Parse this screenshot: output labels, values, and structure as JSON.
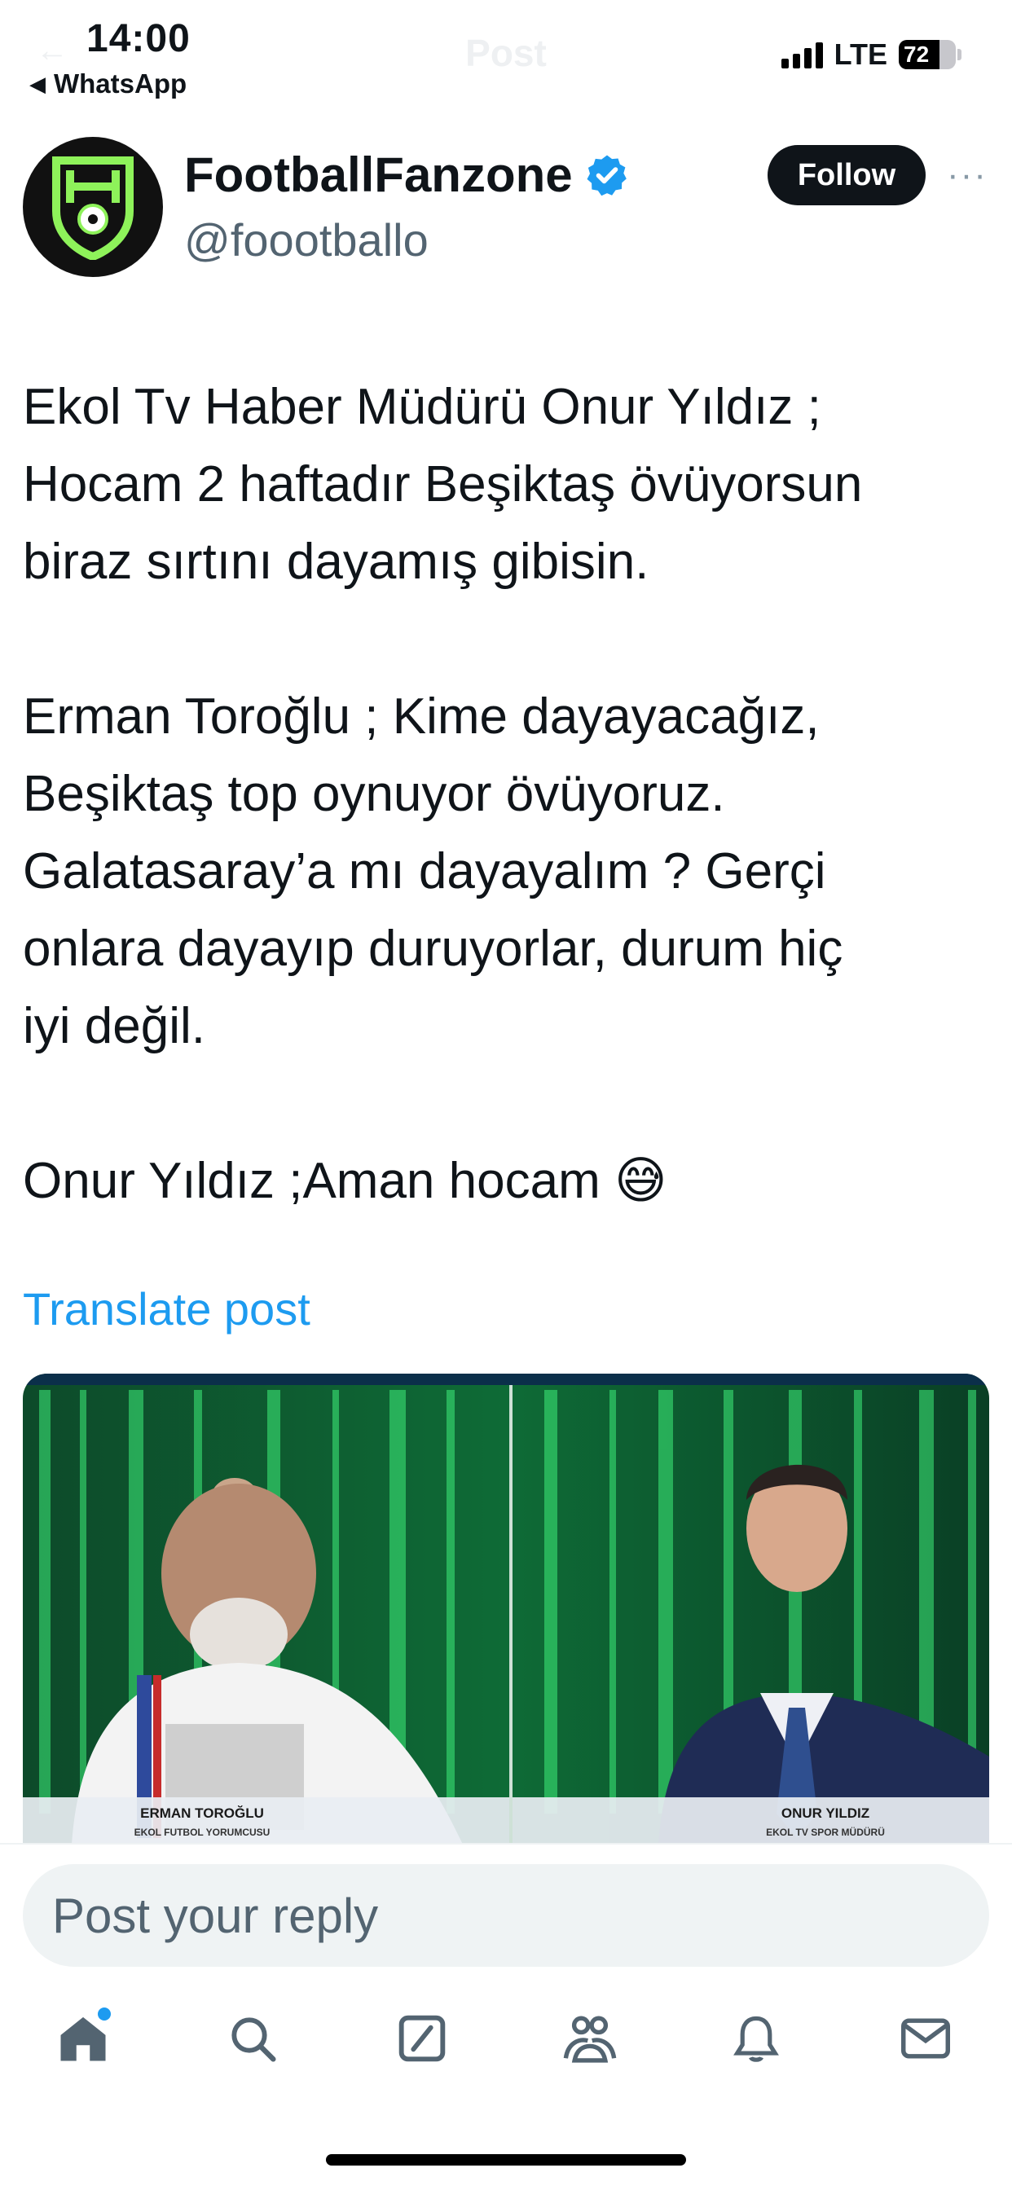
{
  "status_bar": {
    "time": "14:00",
    "back_app": "WhatsApp",
    "network": "LTE",
    "battery": "72",
    "battery_level": 0.72
  },
  "nav": {
    "title": "Post"
  },
  "author": {
    "display_name": "FootballFanzone",
    "handle": "@foootballo",
    "follow_label": "Follow",
    "more_label": "···"
  },
  "post": {
    "paragraphs": [
      "Ekol Tv Haber Müdürü Onur Yıldız ;\nHocam 2 haftadır Beşiktaş övüyorsun\nbiraz sırtını dayamış gibisin.",
      "Erman Toroğlu ; Kime dayayacağız,\nBeşiktaş top oynuyor övüyoruz.\nGalatasaray’a mı dayayalım ? Gerçi\nonlara dayayıp duruyorlar, durum hiç\niyi değil.",
      "Onur Yıldız ;Aman hocam 😅"
    ],
    "translate_label": "Translate post"
  },
  "media": {
    "left_caption_name": "ERMAN TOROĞLU",
    "left_caption_role": "EKOL FUTBOL YORUMCUSU",
    "right_caption_name": "ONUR YILDIZ",
    "right_caption_role": "EKOL TV SPOR MÜDÜRÜ"
  },
  "reply": {
    "placeholder": "Post your reply"
  },
  "tabbar": {
    "items": [
      "home-icon",
      "search-icon",
      "grok-icon",
      "communities-icon",
      "notifications-icon",
      "messages-icon"
    ]
  },
  "colors": {
    "accent": "#1d9bf0",
    "text": "#0f1419",
    "secondary": "#536471",
    "verified": "#1d9bf0",
    "avatar_green": "#8ef25a"
  }
}
